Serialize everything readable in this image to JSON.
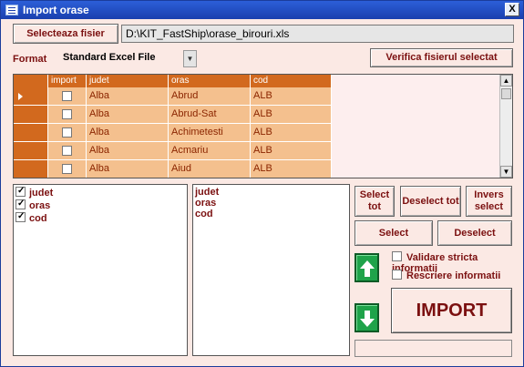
{
  "window": {
    "title": "Import orase",
    "close_label": "X"
  },
  "toolbar": {
    "select_file_label": "Selecteaza fisier",
    "file_path": "D:\\KIT_FastShip\\orase_birouri.xls",
    "format_label": "Format",
    "format_value": "Standard Excel File",
    "verify_label": "Verifica fisierul selectat"
  },
  "grid": {
    "columns": [
      "import",
      "judet",
      "oras",
      "cod"
    ],
    "rows": [
      {
        "import": false,
        "judet": "Alba",
        "oras": "Abrud",
        "cod": "ALB"
      },
      {
        "import": false,
        "judet": "Alba",
        "oras": "Abrud-Sat",
        "cod": "ALB"
      },
      {
        "import": false,
        "judet": "Alba",
        "oras": "Achimetesti",
        "cod": "ALB"
      },
      {
        "import": false,
        "judet": "Alba",
        "oras": "Acmariu",
        "cod": "ALB"
      },
      {
        "import": false,
        "judet": "Alba",
        "oras": "Aiud",
        "cod": "ALB"
      }
    ]
  },
  "left_list": {
    "items": [
      "judet",
      "oras",
      "cod"
    ]
  },
  "right_list": {
    "items": [
      "judet",
      "oras",
      "cod"
    ]
  },
  "buttons": {
    "select_all": "Select tot",
    "deselect_all": "Deselect tot",
    "invert": "Invers select",
    "select": "Select",
    "deselect": "Deselect",
    "import": "IMPORT"
  },
  "options": {
    "strict_validation": "Validare stricta informatii",
    "rewrite": "Rescriere informatii"
  },
  "colors": {
    "accent": "#D2691E",
    "cell": "#F4C08E",
    "text": "#7B1010",
    "background": "#FBE9E4"
  }
}
